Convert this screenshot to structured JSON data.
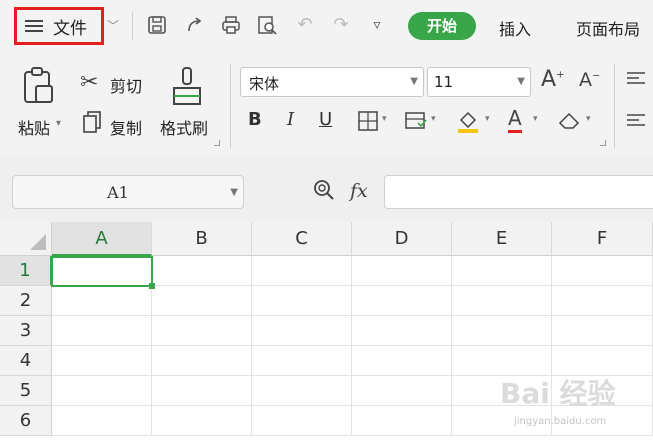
{
  "menubar": {
    "file_label": "文件",
    "start_tab": "开始",
    "tabs": [
      "插入",
      "页面布局"
    ],
    "accent_color": "#3aa64a",
    "highlight_color": "#e01f1f"
  },
  "ribbon": {
    "paste": "粘贴",
    "cut": "剪切",
    "copy": "复制",
    "format_painter": "格式刷",
    "font_name": "宋体",
    "font_size": "11",
    "bold": "B",
    "italic": "I",
    "underline": "U",
    "font_color_letter": "A"
  },
  "formula_bar": {
    "name_box": "A1",
    "fx_label": "fx",
    "formula_value": ""
  },
  "grid": {
    "columns": [
      "A",
      "B",
      "C",
      "D",
      "E",
      "F"
    ],
    "rows": [
      "1",
      "2",
      "3",
      "4",
      "5",
      "6"
    ],
    "selected_cell": "A1"
  },
  "watermark": {
    "brand": "Bai 经验",
    "url": "jingyan.baidu.com"
  }
}
